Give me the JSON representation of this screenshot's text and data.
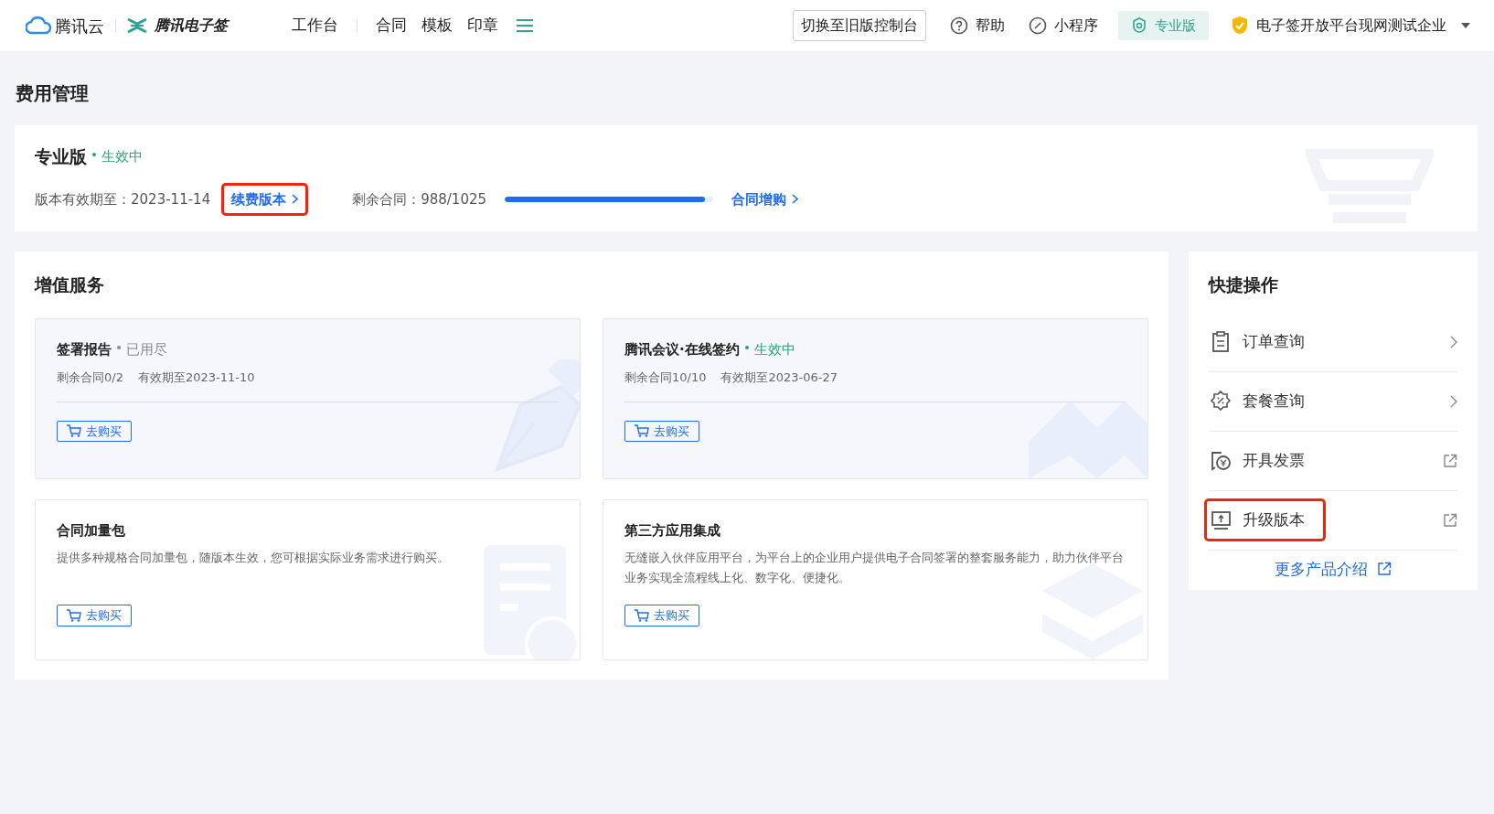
{
  "navbar": {
    "brand": "腾讯云",
    "product": "腾讯电子签",
    "menu_groups": [
      [
        "工作台"
      ],
      [
        "合同",
        "模板",
        "印章"
      ]
    ],
    "switch_button": "切换至旧版控制台",
    "help": "帮助",
    "mini_program": "小程序",
    "edition": "专业版",
    "company": "电子签开放平台现网测试企业"
  },
  "page_title": "费用管理",
  "plan": {
    "name": "专业版",
    "status": "生效中",
    "status_active": true,
    "expiry_label": "版本有效期至：",
    "expiry": "2023-11-14",
    "renew_link": "续费版本",
    "renew_highlighted": true,
    "remaining_label": "剩余合同：",
    "remaining": "988/1025",
    "level": 0.96,
    "buy_more_link": "合同增购"
  },
  "services": {
    "title": "增值服务",
    "cards": [
      {
        "kind": "subscribed",
        "title": "签署报告",
        "status": "已用尽",
        "status_active": false,
        "remaining": "剩余合同0/2",
        "expiry": "有效期至2023-11-10",
        "buy_button": "去购买"
      },
      {
        "kind": "subscribed",
        "title": "腾讯会议·在线签约",
        "status": "生效中",
        "status_active": true,
        "remaining": "剩余合同10/10",
        "expiry": "有效期至2023-06-27",
        "buy_button": "去购买"
      },
      {
        "kind": "product",
        "title": "合同加量包",
        "description": "提供多种规格合同加量包，随版本生效，您可根据实际业务需求进行购买。",
        "buy_button": "去购买"
      },
      {
        "kind": "product",
        "title": "第三方应用集成",
        "description": "无缝嵌入伙伴应用平台，为平台上的企业用户提供电子合同签署的整套服务能力，助力伙伴平台业务实现全流程线上化、数字化、便捷化。",
        "buy_button": "去购买"
      }
    ]
  },
  "quick_actions": {
    "title": "快捷操作",
    "items": [
      {
        "label": "订单查询",
        "kind": "navigate",
        "highlighted": false
      },
      {
        "label": "套餐查询",
        "kind": "navigate",
        "highlighted": false
      },
      {
        "label": "开具发票",
        "kind": "external",
        "highlighted": false
      },
      {
        "label": "升级版本",
        "kind": "external",
        "highlighted": true
      }
    ],
    "more_link": "更多产品介绍"
  }
}
